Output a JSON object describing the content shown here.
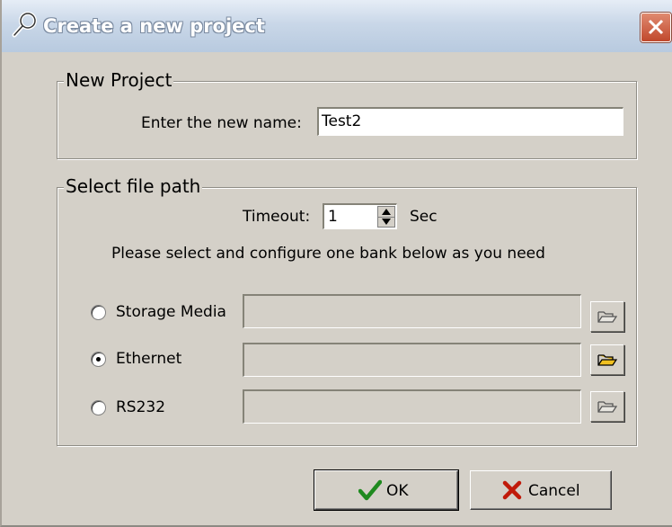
{
  "window": {
    "title": "Create a new project"
  },
  "new_project": {
    "group_label": "New Project",
    "name_label": "Enter the new name:",
    "name_value": "Test2"
  },
  "file_path": {
    "group_label": "Select file path",
    "timeout_label": "Timeout:",
    "timeout_value": "1",
    "timeout_unit": "Sec",
    "instruction": "Please select and configure one bank below as you need",
    "options": [
      {
        "label": "Storage Media",
        "checked": false,
        "path": ""
      },
      {
        "label": "Ethernet",
        "checked": true,
        "path": ""
      },
      {
        "label": "RS232",
        "checked": false,
        "path": ""
      }
    ]
  },
  "buttons": {
    "ok": "OK",
    "cancel": "Cancel"
  },
  "colors": {
    "title_gradient_top": "#e6edf6",
    "title_gradient_bottom": "#b8cadf",
    "dialog_bg": "#d4d0c8",
    "ok_check": "#1f8a1f",
    "cancel_x": "#c01a0a",
    "folder_active": "#f0c020"
  },
  "icons": {
    "title": "wrench-icon",
    "close": "close-icon",
    "browse": "folder-open-icon",
    "ok": "checkmark-icon",
    "cancel": "x-mark-icon"
  }
}
